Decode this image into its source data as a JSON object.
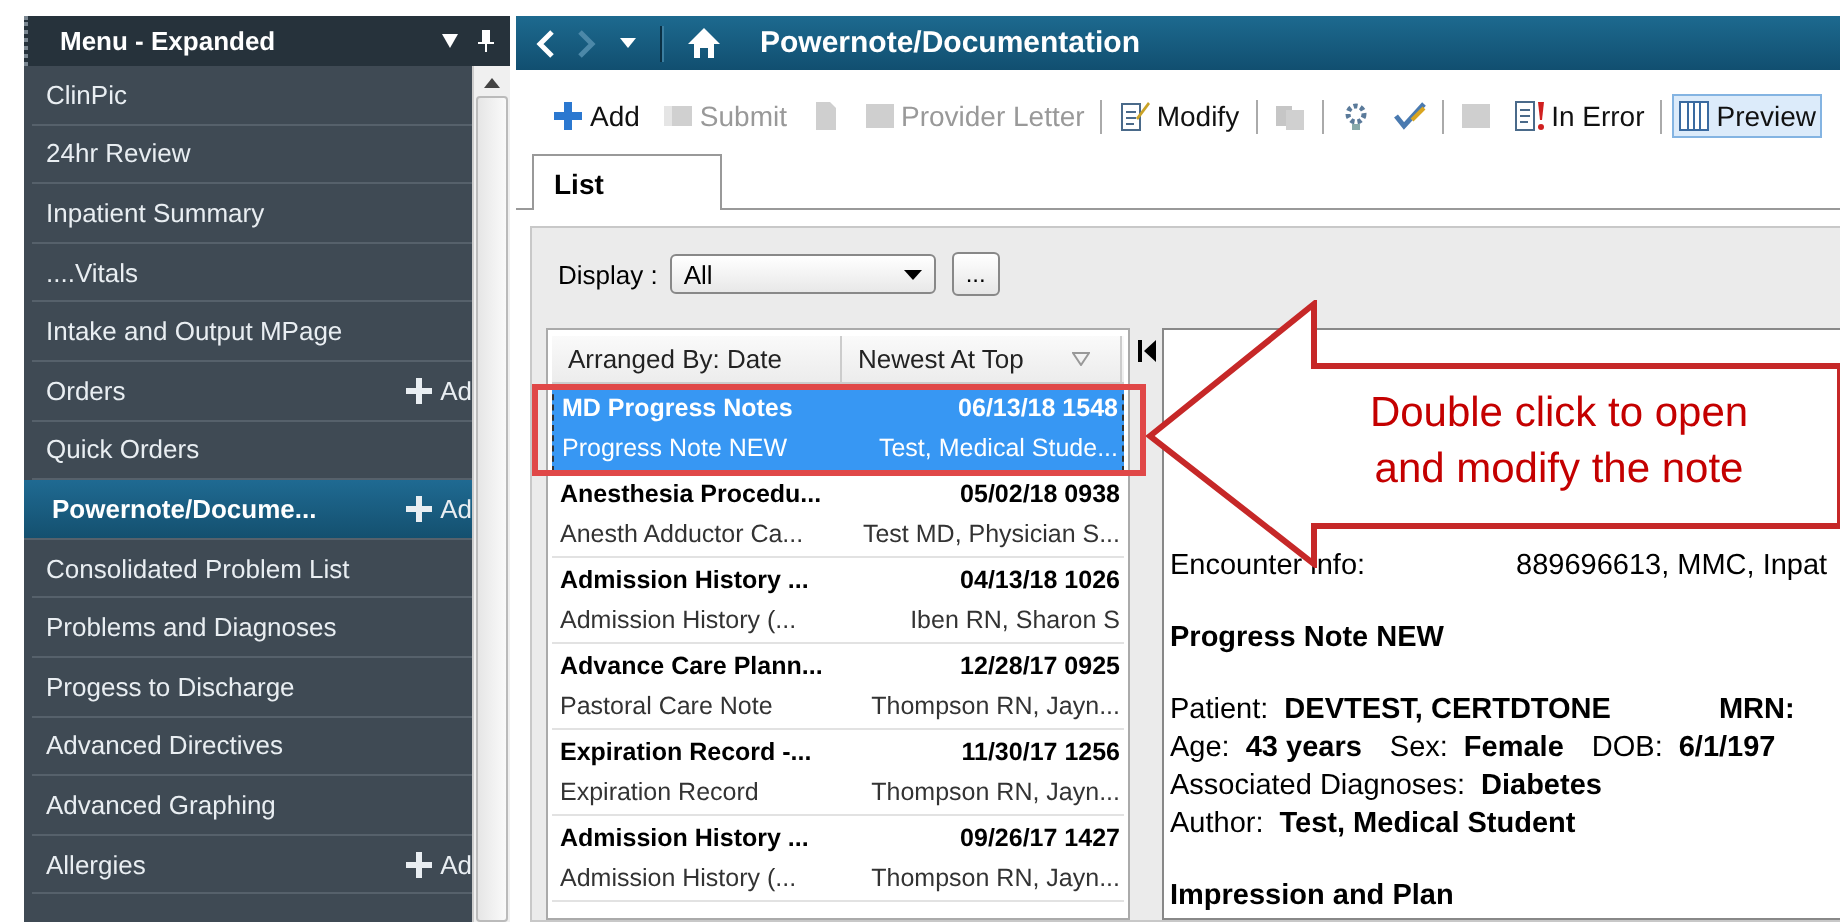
{
  "sidebar": {
    "title": "Menu - Expanded",
    "items": [
      {
        "label": "ClinPic",
        "selected": false
      },
      {
        "label": "24hr Review",
        "selected": false
      },
      {
        "label": "Inpatient Summary",
        "selected": false
      },
      {
        "label": "....Vitals",
        "selected": false
      },
      {
        "label": "Intake and Output MPage",
        "selected": false
      },
      {
        "label": "Orders",
        "selected": false,
        "add": "Ad"
      },
      {
        "label": "Quick Orders",
        "selected": false
      },
      {
        "label": "Powernote/Docume...",
        "selected": true,
        "add": "Ad"
      },
      {
        "label": "Consolidated Problem List",
        "selected": false
      },
      {
        "label": "Problems and Diagnoses",
        "selected": false
      },
      {
        "label": "Progess to Discharge",
        "selected": false
      },
      {
        "label": "Advanced Directives",
        "selected": false
      },
      {
        "label": "Advanced Graphing",
        "selected": false
      },
      {
        "label": "Allergies",
        "selected": false,
        "add": "Ad"
      }
    ]
  },
  "nav": {
    "title": "Powernote/Documentation"
  },
  "toolbar": [
    {
      "kind": "button",
      "label": "Add",
      "disabled": false,
      "pressed": false
    },
    {
      "kind": "button",
      "label": "Submit",
      "disabled": true,
      "pressed": false
    },
    {
      "kind": "icon",
      "disabled": true,
      "pressed": false
    },
    {
      "kind": "button",
      "label": "Provider Letter",
      "disabled": true,
      "pressed": false
    },
    {
      "kind": "separator"
    },
    {
      "kind": "button",
      "label": "Modify",
      "disabled": false,
      "pressed": false
    },
    {
      "kind": "separator"
    },
    {
      "kind": "icon",
      "disabled": true,
      "pressed": false
    },
    {
      "kind": "separator"
    },
    {
      "kind": "icon",
      "disabled": false,
      "pressed": false
    },
    {
      "kind": "icon",
      "disabled": false,
      "pressed": false
    },
    {
      "kind": "separator"
    },
    {
      "kind": "icon",
      "disabled": true,
      "pressed": false
    },
    {
      "kind": "button",
      "label": "In Error",
      "disabled": false,
      "pressed": false
    },
    {
      "kind": "separator"
    },
    {
      "kind": "button",
      "label": "Preview",
      "disabled": false,
      "pressed": true
    }
  ],
  "tabs": [
    {
      "label": "List",
      "selected": true
    }
  ],
  "display": {
    "label": "Display :",
    "value": "All",
    "more": "..."
  },
  "list": {
    "columns": [
      "Arranged By: Date",
      "Newest At Top"
    ],
    "rows": [
      {
        "title": "MD Progress Notes",
        "date": "06/13/18 1548",
        "subtitle": "Progress Note NEW",
        "author": "Test, Medical Stude...",
        "selected": true
      },
      {
        "title": "Anesthesia Procedu...",
        "date": "05/02/18 0938",
        "subtitle": "Anesth Adductor Ca...",
        "author": "Test MD, Physician S...",
        "selected": false
      },
      {
        "title": "Admission History ...",
        "date": "04/13/18 1026",
        "subtitle": "Admission History (...",
        "author": "Iben RN, Sharon S",
        "selected": false
      },
      {
        "title": "Advance Care Plann...",
        "date": "12/28/17 0925",
        "subtitle": "Pastoral Care Note",
        "author": "Thompson RN, Jayn...",
        "selected": false
      },
      {
        "title": "Expiration Record -...",
        "date": "11/30/17 1256",
        "subtitle": "Expiration Record",
        "author": "Thompson RN, Jayn...",
        "selected": false
      },
      {
        "title": "Admission History ...",
        "date": "09/26/17 1427",
        "subtitle": "Admission History (...",
        "author": "Thompson RN, Jayn...",
        "selected": false
      }
    ]
  },
  "preview": {
    "lines": [
      {
        "kind": "field",
        "label": "Encounter info:",
        "value": "889696613, MMC, Inpat"
      },
      {
        "kind": "heading",
        "text": "Progress Note NEW"
      },
      {
        "kind": "pairs",
        "items": [
          {
            "label": "Patient:",
            "value": "DEVTEST, CERTDTONE"
          },
          {
            "value": "MRN:"
          }
        ]
      },
      {
        "kind": "pairs",
        "items": [
          {
            "label": "Age:",
            "value": "43 years"
          },
          {
            "label": "Sex:",
            "value": "Female"
          },
          {
            "label": "DOB:",
            "value": "6/1/197"
          }
        ]
      },
      {
        "kind": "pairs",
        "items": [
          {
            "label": "Associated Diagnoses:",
            "value": "Diabetes"
          }
        ]
      },
      {
        "kind": "pairs",
        "items": [
          {
            "label": "Author:",
            "value": "Test, Medical Student"
          }
        ]
      },
      {
        "kind": "heading",
        "text": "Impression and Plan"
      }
    ]
  },
  "callout": {
    "text": "Double click to open and modify the note"
  }
}
